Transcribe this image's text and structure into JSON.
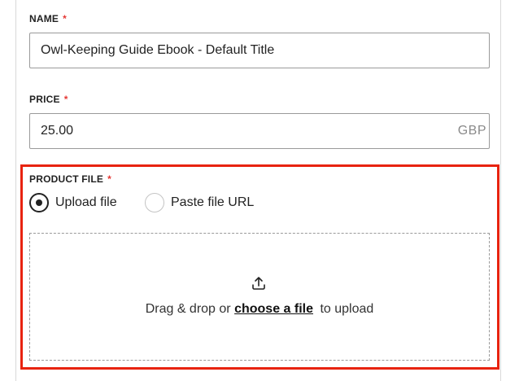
{
  "form": {
    "name": {
      "label": "NAME",
      "required_mark": "*",
      "value": "Owl-Keeping Guide Ebook - Default Title"
    },
    "price": {
      "label": "PRICE",
      "required_mark": "*",
      "value": "25.00",
      "currency": "GBP"
    },
    "product_file": {
      "label": "PRODUCT FILE",
      "required_mark": "*",
      "options": [
        {
          "label": "Upload file",
          "selected": true
        },
        {
          "label": "Paste file URL",
          "selected": false
        }
      ],
      "dropzone": {
        "text_before": "Drag & drop or",
        "link": "choose a file",
        "text_after": "to upload",
        "icon": "upload-icon"
      }
    }
  },
  "colors": {
    "required": "#e53935",
    "highlight": "#e8230f"
  }
}
